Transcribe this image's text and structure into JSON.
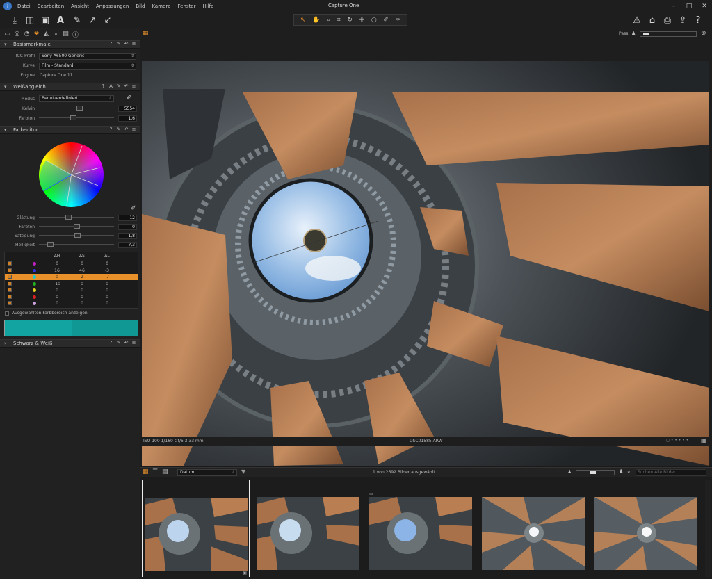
{
  "app": {
    "title": "Capture One",
    "menu": [
      "Datei",
      "Bearbeiten",
      "Ansicht",
      "Anpassungen",
      "Bild",
      "Kamera",
      "Fenster",
      "Hilfe"
    ],
    "window_controls": [
      "–",
      "□",
      "✕"
    ]
  },
  "toolbar": {
    "left_icons": [
      "import-icon",
      "capture-icon",
      "process-icon",
      "text-icon",
      "brush-icon",
      "arrow-up-icon",
      "arrow-down-icon"
    ],
    "cursor_tools": [
      "select-icon",
      "pan-icon",
      "loupe-icon",
      "crop-icon",
      "rotate-icon",
      "spot-icon",
      "circle-icon",
      "picker-icon",
      "erase-icon"
    ],
    "right_icons": [
      "warning-icon",
      "overlay-icon",
      "print-icon",
      "export-icon",
      "help-icon"
    ]
  },
  "left_tabs": [
    "folder-icon",
    "capture-icon",
    "color-icon",
    "exposure-icon",
    "details-icon",
    "search-icon",
    "metadata-icon",
    "info-icon"
  ],
  "basic": {
    "title": "Basismerkmale",
    "icc_label": "ICC-Profil",
    "icc_value": "Sony A6500 Generic",
    "curve_label": "Kurve",
    "curve_value": "Film - Standard",
    "engine_label": "Engine",
    "engine_value": "Capture One 11"
  },
  "wb": {
    "title": "Weißabgleich",
    "mode_label": "Modus",
    "mode_value": "Benutzerdefiniert",
    "kelvin_label": "Kelvin",
    "kelvin_value": "5554",
    "tint_label": "Farbton",
    "tint_value": "1,6",
    "kelvin_pos": 0.55,
    "tint_pos": 0.45
  },
  "coloreditor": {
    "title": "Farbeditor",
    "smooth_label": "Glättung",
    "smooth_value": "12",
    "hue_label": "Farbton",
    "hue_value": "0",
    "sat_label": "Sättigung",
    "sat_value": "1,8",
    "light_label": "Helligkeit",
    "light_value": "-7,3",
    "smooth_pos": 0.38,
    "hue_pos": 0.5,
    "sat_pos": 0.52,
    "light_pos": 0.12,
    "col_h": "ΔH",
    "col_s": "ΔS",
    "col_l": "ΔL",
    "rows": [
      {
        "color": "#c020c0",
        "h": "0",
        "s": "0",
        "l": "0"
      },
      {
        "color": "#3030e0",
        "h": "16",
        "s": "46",
        "l": "-3"
      },
      {
        "color": "#20c8d0",
        "h": "0",
        "s": "2",
        "l": "-7"
      },
      {
        "color": "#20b020",
        "h": "-10",
        "s": "0",
        "l": "0"
      },
      {
        "color": "#e0d020",
        "h": "0",
        "s": "0",
        "l": "0"
      },
      {
        "color": "#e02020",
        "h": "0",
        "s": "0",
        "l": "0"
      },
      {
        "color": "#d0a0e0",
        "h": "0",
        "s": "0",
        "l": "0"
      }
    ],
    "show_range_label": "Ausgewählten Farbbereich anzeigen",
    "teal_left": "#11a4a0",
    "teal_right": "#109994"
  },
  "bw": {
    "title": "Schwarz & Weiß"
  },
  "viewer": {
    "pass_label": "Pass.",
    "info_left": "ISO 100  1/160 s  f/6,3  33 mm",
    "filename": "DSC01585.ARW"
  },
  "browser": {
    "sort_value": "Datum",
    "count_text": "1 von 2692 Bilder ausgewählt",
    "search_placeholder": "Suchen Alle Bilder"
  },
  "colors": {
    "accent": "#e8902a"
  }
}
